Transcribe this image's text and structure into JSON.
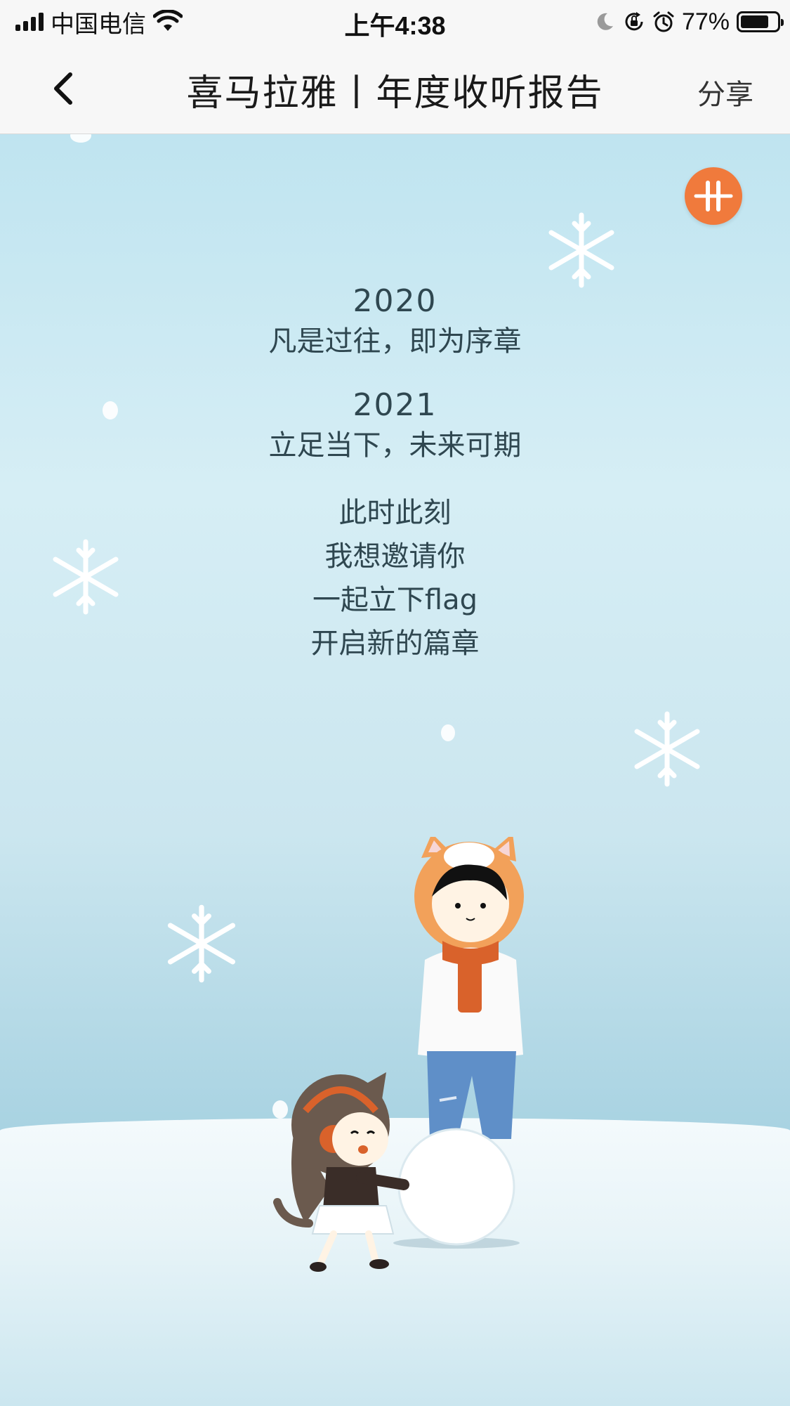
{
  "status_bar": {
    "carrier": "中国电信",
    "time": "上午4:38",
    "battery_percent": "77%",
    "battery_level": 0.77,
    "icons": [
      "signal-icon",
      "wifi-icon",
      "moon-icon",
      "rotation-lock-icon",
      "alarm-icon",
      "battery-icon"
    ]
  },
  "nav": {
    "title": "喜马拉雅丨年度收听报告",
    "share_label": "分享",
    "back_icon": "chevron-left-icon"
  },
  "poem": {
    "year_2020": "2020",
    "line_2020": "凡是过往，即为序章",
    "year_2021": "2021",
    "line_2021": "立足当下，未来可期",
    "invite_lines": [
      "此时此刻",
      "我想邀请你",
      "一起立下flag",
      "开启新的篇章"
    ]
  },
  "music_button": {
    "icon": "music-wave-icon",
    "color": "#f07a3c"
  },
  "colors": {
    "text": "#2f4750",
    "sky_top": "#bfe4f0",
    "snow": "#f4fafc",
    "accent": "#f07a3c"
  }
}
